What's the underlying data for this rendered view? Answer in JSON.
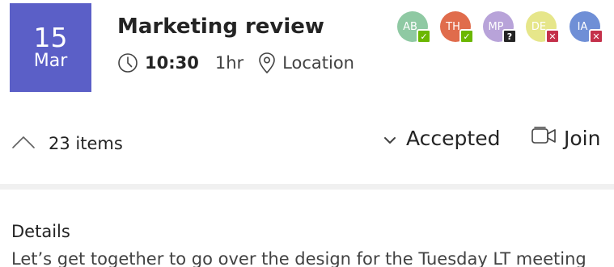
{
  "event": {
    "date_day": "15",
    "date_month": "Mar",
    "title": "Marketing review",
    "time": "10:30",
    "duration": "1hr",
    "location_placeholder": "Location",
    "items_count_label": "23 items",
    "rsvp_status": "Accepted",
    "join_label": "Join",
    "details_heading": "Details",
    "details_text": "Let’s get together to go over the design for the Tuesday LT meeting"
  },
  "attendees": [
    {
      "initials": "AB",
      "color": "#8fc9a3",
      "status": "accepted",
      "badge_color": "#6bb700",
      "badge_symbol": "✓"
    },
    {
      "initials": "TH",
      "color": "#e06c4c",
      "status": "accepted",
      "badge_color": "#6bb700",
      "badge_symbol": "✓"
    },
    {
      "initials": "MP",
      "color": "#b8a3d9",
      "status": "tentative",
      "badge_color": "#242424",
      "badge_symbol": "?"
    },
    {
      "initials": "DE",
      "color": "#e6e68a",
      "status": "declined",
      "badge_color": "#c4314b",
      "badge_symbol": "✕"
    },
    {
      "initials": "IA",
      "color": "#6f8fd6",
      "status": "declined",
      "badge_color": "#c4314b",
      "badge_symbol": "✕"
    }
  ],
  "colors": {
    "date_tile": "#5b5fc7",
    "accepted": "#6bb700",
    "declined": "#c4314b",
    "tentative": "#242424"
  },
  "icons": {
    "time": "clock-icon",
    "location": "location-pin-icon",
    "expand": "chevron-up-icon",
    "rsvp": "chevron-down-icon",
    "join": "video-camera-icon"
  }
}
